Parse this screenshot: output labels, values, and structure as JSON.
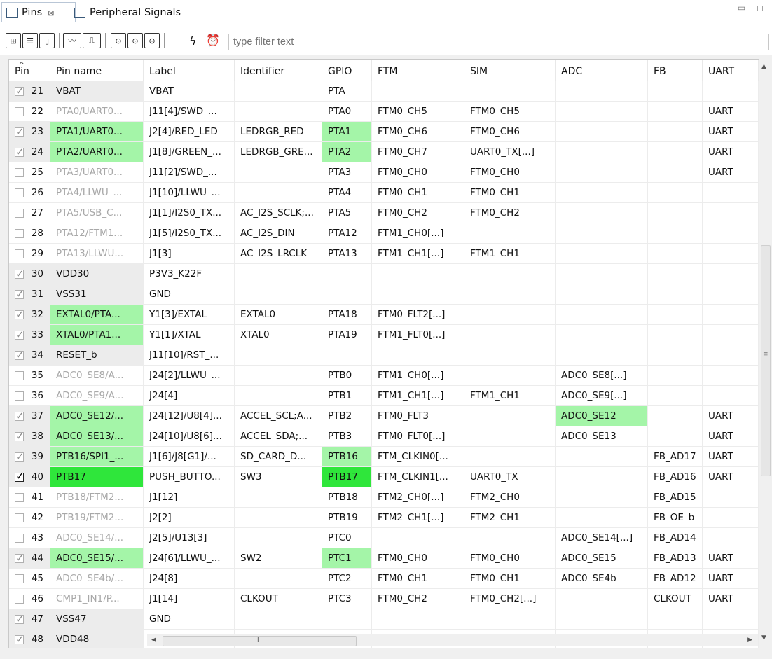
{
  "tabs": [
    {
      "label": "Pins",
      "close": "⊠"
    },
    {
      "label": "Peripheral Signals"
    }
  ],
  "window_controls": "▭ ◻",
  "filter": {
    "placeholder": "type filter text"
  },
  "columns": [
    "Pin",
    "Pin name",
    "Label",
    "Identifier",
    "GPIO",
    "FTM",
    "SIM",
    "ADC",
    "FB",
    "UART"
  ],
  "rows": [
    {
      "pin": "21",
      "name": "VBAT",
      "label": "VBAT",
      "identifier": "",
      "gpio": "PTA",
      "ftm": "",
      "sim": "",
      "adc": "",
      "fb": "",
      "uart": "",
      "check": "on",
      "dim": false,
      "hl": {}
    },
    {
      "pin": "22",
      "name": "PTA0/UART0...",
      "label": "J11[4]/SWD_...",
      "identifier": "",
      "gpio": "PTA0",
      "ftm": "FTM0_CH5",
      "sim": "FTM0_CH5",
      "adc": "",
      "fb": "",
      "uart": "UART",
      "check": "off",
      "dim": true,
      "hl": {}
    },
    {
      "pin": "23",
      "name": "PTA1/UART0...",
      "label": "J2[4]/RED_LED",
      "identifier": "LEDRGB_RED",
      "gpio": "PTA1",
      "ftm": "FTM0_CH6",
      "sim": "FTM0_CH6",
      "adc": "",
      "fb": "",
      "uart": "UART",
      "check": "on",
      "dim": false,
      "hl": {
        "name": "lg",
        "gpio": "lg"
      }
    },
    {
      "pin": "24",
      "name": "PTA2/UART0...",
      "label": "J1[8]/GREEN_...",
      "identifier": "LEDRGB_GRE...",
      "gpio": "PTA2",
      "ftm": "FTM0_CH7",
      "sim": "UART0_TX[...]",
      "adc": "",
      "fb": "",
      "uart": "UART",
      "check": "on",
      "dim": false,
      "hl": {
        "name": "lg",
        "gpio": "lg"
      }
    },
    {
      "pin": "25",
      "name": "PTA3/UART0...",
      "label": "J11[2]/SWD_...",
      "identifier": "",
      "gpio": "PTA3",
      "ftm": "FTM0_CH0",
      "sim": "FTM0_CH0",
      "adc": "",
      "fb": "",
      "uart": "UART",
      "check": "off",
      "dim": true,
      "hl": {}
    },
    {
      "pin": "26",
      "name": "PTA4/LLWU_...",
      "label": "J1[10]/LLWU_...",
      "identifier": "",
      "gpio": "PTA4",
      "ftm": "FTM0_CH1",
      "sim": "FTM0_CH1",
      "adc": "",
      "fb": "",
      "uart": "",
      "check": "off",
      "dim": true,
      "hl": {}
    },
    {
      "pin": "27",
      "name": "PTA5/USB_C...",
      "label": "J1[1]/I2S0_TX...",
      "identifier": "AC_I2S_SCLK;...",
      "gpio": "PTA5",
      "ftm": "FTM0_CH2",
      "sim": "FTM0_CH2",
      "adc": "",
      "fb": "",
      "uart": "",
      "check": "off",
      "dim": true,
      "hl": {}
    },
    {
      "pin": "28",
      "name": "PTA12/FTM1...",
      "label": "J1[5]/I2S0_TX...",
      "identifier": "AC_I2S_DIN",
      "gpio": "PTA12",
      "ftm": "FTM1_CH0[...]",
      "sim": "",
      "adc": "",
      "fb": "",
      "uart": "",
      "check": "off",
      "dim": true,
      "hl": {}
    },
    {
      "pin": "29",
      "name": "PTA13/LLWU...",
      "label": "J1[3]",
      "identifier": "AC_I2S_LRCLK",
      "gpio": "PTA13",
      "ftm": "FTM1_CH1[...]",
      "sim": "FTM1_CH1",
      "adc": "",
      "fb": "",
      "uart": "",
      "check": "off",
      "dim": true,
      "hl": {}
    },
    {
      "pin": "30",
      "name": "VDD30",
      "label": "P3V3_K22F",
      "identifier": "",
      "gpio": "",
      "ftm": "",
      "sim": "",
      "adc": "",
      "fb": "",
      "uart": "",
      "check": "on",
      "dim": false,
      "hl": {}
    },
    {
      "pin": "31",
      "name": "VSS31",
      "label": "GND",
      "identifier": "",
      "gpio": "",
      "ftm": "",
      "sim": "",
      "adc": "",
      "fb": "",
      "uart": "",
      "check": "on",
      "dim": false,
      "hl": {}
    },
    {
      "pin": "32",
      "name": "EXTAL0/PTA...",
      "label": "Y1[3]/EXTAL",
      "identifier": "EXTAL0",
      "gpio": "PTA18",
      "ftm": "FTM0_FLT2[...]",
      "sim": "",
      "adc": "",
      "fb": "",
      "uart": "",
      "check": "on",
      "dim": false,
      "hl": {
        "name": "lg"
      }
    },
    {
      "pin": "33",
      "name": "XTAL0/PTA1...",
      "label": "Y1[1]/XTAL",
      "identifier": "XTAL0",
      "gpio": "PTA19",
      "ftm": "FTM1_FLT0[...]",
      "sim": "",
      "adc": "",
      "fb": "",
      "uart": "",
      "check": "on",
      "dim": false,
      "hl": {
        "name": "lg"
      }
    },
    {
      "pin": "34",
      "name": "RESET_b",
      "label": "J11[10]/RST_...",
      "identifier": "",
      "gpio": "",
      "ftm": "",
      "sim": "",
      "adc": "",
      "fb": "",
      "uart": "",
      "check": "on",
      "dim": false,
      "hl": {}
    },
    {
      "pin": "35",
      "name": "ADC0_SE8/A...",
      "label": "J24[2]/LLWU_...",
      "identifier": "",
      "gpio": "PTB0",
      "ftm": "FTM1_CH0[...]",
      "sim": "",
      "adc": "ADC0_SE8[...]",
      "fb": "",
      "uart": "",
      "check": "off",
      "dim": true,
      "hl": {}
    },
    {
      "pin": "36",
      "name": "ADC0_SE9/A...",
      "label": "J24[4]",
      "identifier": "",
      "gpio": "PTB1",
      "ftm": "FTM1_CH1[...]",
      "sim": "FTM1_CH1",
      "adc": "ADC0_SE9[...]",
      "fb": "",
      "uart": "",
      "check": "off",
      "dim": true,
      "hl": {}
    },
    {
      "pin": "37",
      "name": "ADC0_SE12/...",
      "label": "J24[12]/U8[4]...",
      "identifier": "ACCEL_SCL;A...",
      "gpio": "PTB2",
      "ftm": "FTM0_FLT3",
      "sim": "",
      "adc": "ADC0_SE12",
      "fb": "",
      "uart": "UART",
      "check": "on",
      "dim": false,
      "hl": {
        "name": "lg",
        "adc": "lg"
      }
    },
    {
      "pin": "38",
      "name": "ADC0_SE13/...",
      "label": "J24[10]/U8[6]...",
      "identifier": "ACCEL_SDA;...",
      "gpio": "PTB3",
      "ftm": "FTM0_FLT0[...]",
      "sim": "",
      "adc": "ADC0_SE13",
      "fb": "",
      "uart": "UART",
      "check": "on",
      "dim": false,
      "hl": {
        "name": "lg"
      }
    },
    {
      "pin": "39",
      "name": "PTB16/SPI1_...",
      "label": "J1[6]/J8[G1]/...",
      "identifier": "SD_CARD_D...",
      "gpio": "PTB16",
      "ftm": "FTM_CLKIN0[...",
      "sim": "",
      "adc": "",
      "fb": "FB_AD17",
      "uart": "UART",
      "check": "on",
      "dim": false,
      "hl": {
        "name": "lg",
        "gpio": "lg"
      }
    },
    {
      "pin": "40",
      "name": "PTB17",
      "label": "PUSH_BUTTO...",
      "identifier": "SW3",
      "gpio": "PTB17",
      "ftm": "FTM_CLKIN1[...",
      "sim": "UART0_TX",
      "adc": "",
      "fb": "FB_AD16",
      "uart": "UART",
      "check": "strong",
      "dim": false,
      "hl": {
        "name": "bg",
        "gpio": "bg"
      }
    },
    {
      "pin": "41",
      "name": "PTB18/FTM2...",
      "label": "J1[12]",
      "identifier": "",
      "gpio": "PTB18",
      "ftm": "FTM2_CH0[...]",
      "sim": "FTM2_CH0",
      "adc": "",
      "fb": "FB_AD15",
      "uart": "",
      "check": "off",
      "dim": true,
      "hl": {}
    },
    {
      "pin": "42",
      "name": "PTB19/FTM2...",
      "label": "J2[2]",
      "identifier": "",
      "gpio": "PTB19",
      "ftm": "FTM2_CH1[...]",
      "sim": "FTM2_CH1",
      "adc": "",
      "fb": "FB_OE_b",
      "uart": "",
      "check": "off",
      "dim": true,
      "hl": {}
    },
    {
      "pin": "43",
      "name": "ADC0_SE14/...",
      "label": "J2[5]/U13[3]",
      "identifier": "",
      "gpio": "PTC0",
      "ftm": "",
      "sim": "",
      "adc": "ADC0_SE14[...]",
      "fb": "FB_AD14",
      "uart": "",
      "check": "off",
      "dim": true,
      "hl": {}
    },
    {
      "pin": "44",
      "name": "ADC0_SE15/...",
      "label": "J24[6]/LLWU_...",
      "identifier": "SW2",
      "gpio": "PTC1",
      "ftm": "FTM0_CH0",
      "sim": "FTM0_CH0",
      "adc": "ADC0_SE15",
      "fb": "FB_AD13",
      "uart": "UART",
      "check": "on",
      "dim": false,
      "hl": {
        "name": "lg",
        "gpio": "lg"
      }
    },
    {
      "pin": "45",
      "name": "ADC0_SE4b/...",
      "label": "J24[8]",
      "identifier": "",
      "gpio": "PTC2",
      "ftm": "FTM0_CH1",
      "sim": "FTM0_CH1",
      "adc": "ADC0_SE4b",
      "fb": "FB_AD12",
      "uart": "UART",
      "check": "off",
      "dim": true,
      "hl": {}
    },
    {
      "pin": "46",
      "name": "CMP1_IN1/P...",
      "label": "J1[14]",
      "identifier": "CLKOUT",
      "gpio": "PTC3",
      "ftm": "FTM0_CH2",
      "sim": "FTM0_CH2[...]",
      "adc": "",
      "fb": "CLKOUT",
      "uart": "UART",
      "check": "off",
      "dim": true,
      "hl": {}
    },
    {
      "pin": "47",
      "name": "VSS47",
      "label": "GND",
      "identifier": "",
      "gpio": "",
      "ftm": "",
      "sim": "",
      "adc": "",
      "fb": "",
      "uart": "",
      "check": "on",
      "dim": false,
      "hl": {}
    },
    {
      "pin": "48",
      "name": "VDD48",
      "label": "",
      "identifier": "",
      "gpio": "",
      "ftm": "",
      "sim": "",
      "adc": "",
      "fb": "",
      "uart": "",
      "check": "on",
      "dim": false,
      "hl": {}
    }
  ],
  "colors": {
    "light_green": "#a4f5a8",
    "bright_green": "#2fe63b",
    "dim_text": "#a8a8a8"
  },
  "hscroll_grip": "III"
}
